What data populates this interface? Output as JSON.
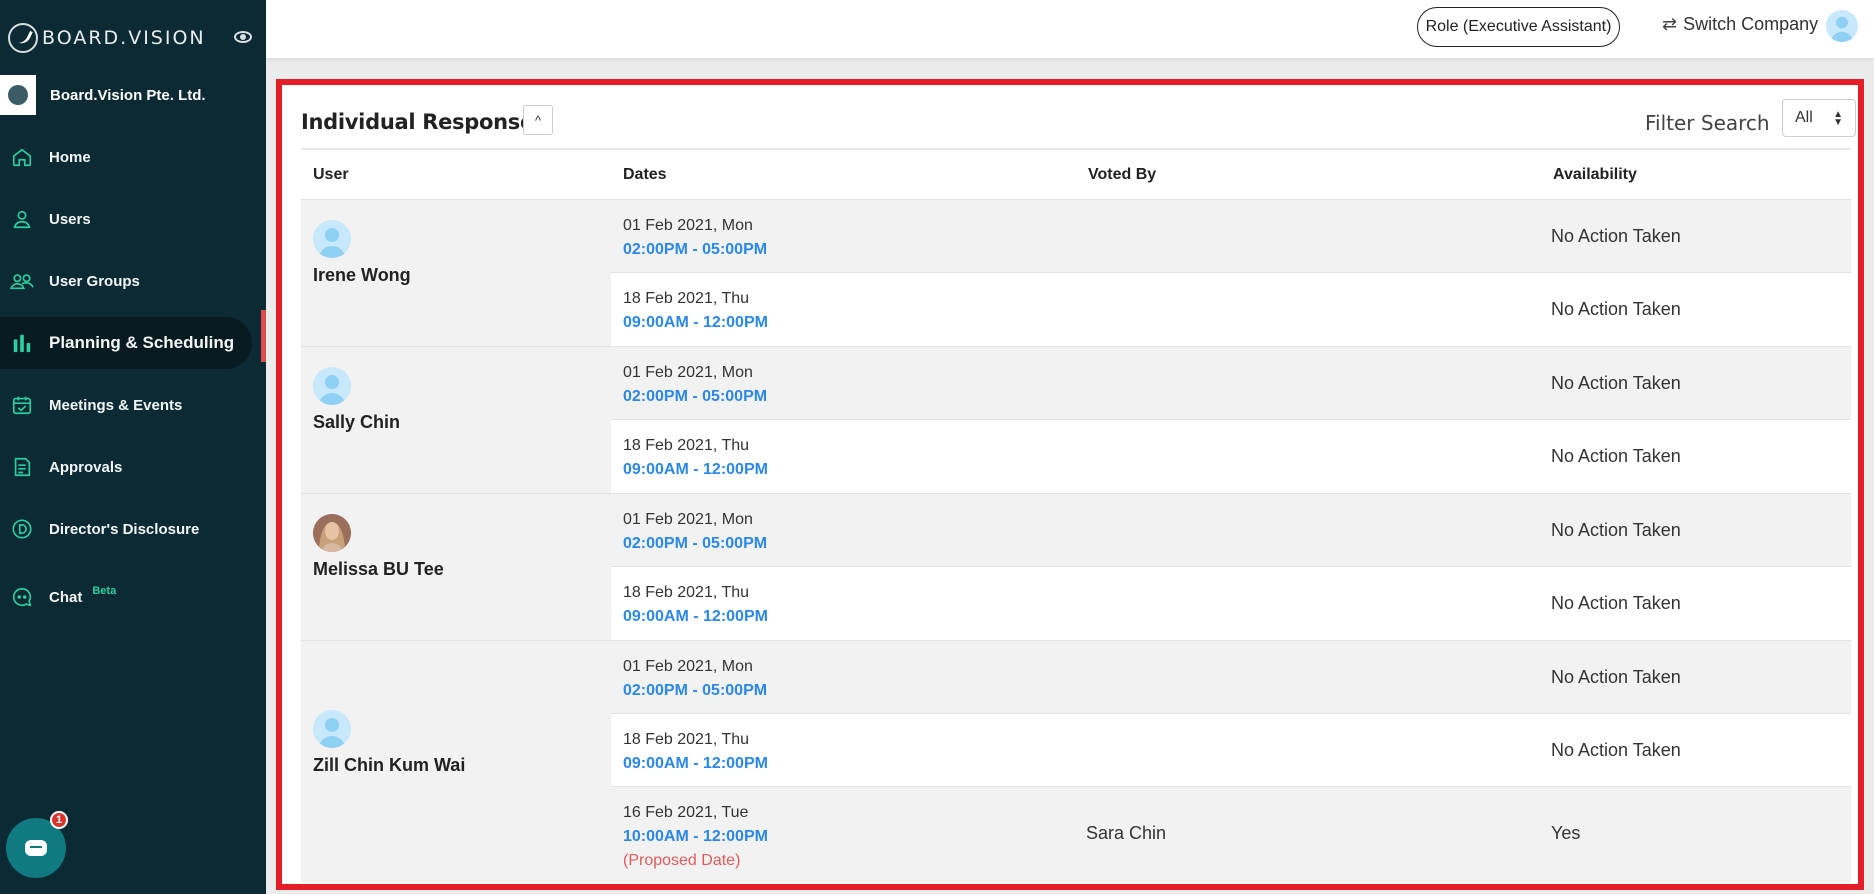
{
  "sidebar": {
    "brand": "BOARD.VISION",
    "company": "Board.Vision Pte. Ltd.",
    "items": [
      {
        "label": "Home",
        "icon": "home-icon"
      },
      {
        "label": "Users",
        "icon": "user-icon"
      },
      {
        "label": "User Groups",
        "icon": "user-groups-icon"
      },
      {
        "label": "Planning & Scheduling",
        "icon": "bar-chart-icon",
        "active": true
      },
      {
        "label": "Meetings & Events",
        "icon": "calendar-check-icon"
      },
      {
        "label": "Approvals",
        "icon": "document-icon"
      },
      {
        "label": "Director's Disclosure",
        "icon": "d-circle-icon"
      },
      {
        "label": "Chat",
        "icon": "chat-icon",
        "badge": "Beta"
      }
    ],
    "chat_fab_badge": "1"
  },
  "header": {
    "role_button": "Role (Executive Assistant)",
    "switch_company": "Switch Company"
  },
  "panel": {
    "title": "Individual Responses",
    "filter_label": "Filter Search",
    "filter_value": "All",
    "columns": [
      "User",
      "Dates",
      "Voted By",
      "Availability"
    ]
  },
  "responses": [
    {
      "user": "Irene Wong",
      "avatar": "default",
      "dates": [
        {
          "date": "01 Feb 2021, Mon",
          "time": "02:00PM - 05:00PM",
          "voted_by": "",
          "availability": "No Action Taken"
        },
        {
          "date": "18 Feb 2021, Thu",
          "time": "09:00AM - 12:00PM",
          "voted_by": "",
          "availability": "No Action Taken"
        }
      ]
    },
    {
      "user": "Sally Chin",
      "avatar": "default",
      "dates": [
        {
          "date": "01 Feb 2021, Mon",
          "time": "02:00PM - 05:00PM",
          "voted_by": "",
          "availability": "No Action Taken"
        },
        {
          "date": "18 Feb 2021, Thu",
          "time": "09:00AM - 12:00PM",
          "voted_by": "",
          "availability": "No Action Taken"
        }
      ]
    },
    {
      "user": "Melissa BU Tee",
      "avatar": "photo",
      "dates": [
        {
          "date": "01 Feb 2021, Mon",
          "time": "02:00PM - 05:00PM",
          "voted_by": "",
          "availability": "No Action Taken"
        },
        {
          "date": "18 Feb 2021, Thu",
          "time": "09:00AM - 12:00PM",
          "voted_by": "",
          "availability": "No Action Taken"
        }
      ]
    },
    {
      "user": "Zill Chin Kum Wai",
      "avatar": "default",
      "dates": [
        {
          "date": "01 Feb 2021, Mon",
          "time": "02:00PM - 05:00PM",
          "voted_by": "",
          "availability": "No Action Taken"
        },
        {
          "date": "18 Feb 2021, Thu",
          "time": "09:00AM - 12:00PM",
          "voted_by": "",
          "availability": "No Action Taken"
        },
        {
          "date": "16 Feb 2021, Tue",
          "time": "10:00AM - 12:00PM",
          "note": "(Proposed Date)",
          "voted_by": "Sara Chin",
          "availability": "Yes"
        }
      ]
    }
  ],
  "colors": {
    "sidebar_bg": "#0c2a33",
    "accent_green": "#2ad0a2",
    "time_blue": "#2b88e6",
    "highlight_red": "#e41e26",
    "proposed_red": "#e05a5a"
  }
}
